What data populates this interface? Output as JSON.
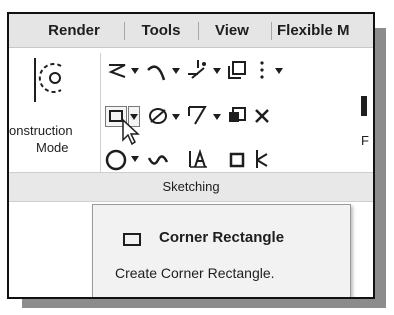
{
  "tabs": [
    {
      "label": "Render"
    },
    {
      "label": "Tools"
    },
    {
      "label": "View"
    },
    {
      "label": "Flexible M"
    }
  ],
  "ribbon": {
    "construction_mode_label_line1": "onstruction",
    "construction_mode_label_line2": "Mode",
    "right_edge_label": "F",
    "panel_title": "Sketching"
  },
  "tooltip": {
    "title": "Corner Rectangle",
    "description": "Create Corner Rectangle."
  },
  "icons": [
    "construction-mode-icon",
    "polyline-icon",
    "arc-icon",
    "points-icon",
    "offset-icon",
    "corner-rectangle-icon",
    "circle-icon",
    "ellipse-icon",
    "spline-icon",
    "text-icon",
    "trim-icon",
    "project-icon",
    "mirror-icon",
    "dimension-icon",
    "cursor-arrow-icon"
  ]
}
